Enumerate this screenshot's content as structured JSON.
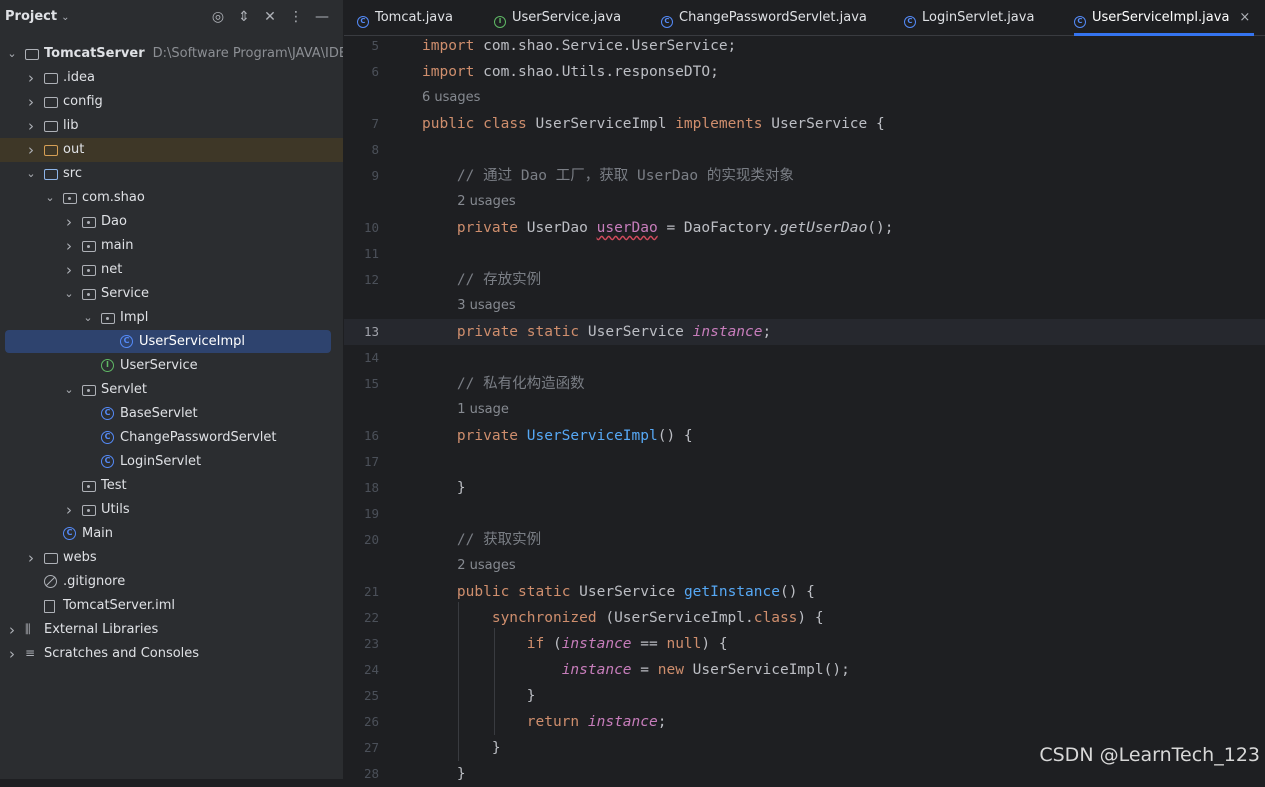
{
  "sidebar": {
    "title": "Project",
    "tree": [
      {
        "label": "TomcatServer",
        "path": "D:\\Software Program\\JAVA\\IDEA\\",
        "icon": "project-folder-icon",
        "state": "open",
        "bold": true
      },
      {
        "label": ".idea",
        "icon": "folder-icon",
        "state": "closed"
      },
      {
        "label": "config",
        "icon": "folder-icon",
        "state": "closed"
      },
      {
        "label": "lib",
        "icon": "folder-icon",
        "state": "closed"
      },
      {
        "label": "out",
        "icon": "excluded-folder-icon",
        "state": "closed",
        "highlight": true
      },
      {
        "label": "src",
        "icon": "source-folder-icon",
        "state": "open"
      },
      {
        "label": "com.shao",
        "icon": "package-icon",
        "state": "open"
      },
      {
        "label": "Dao",
        "icon": "package-icon",
        "state": "closed"
      },
      {
        "label": "main",
        "icon": "package-icon",
        "state": "closed"
      },
      {
        "label": "net",
        "icon": "package-icon",
        "state": "closed"
      },
      {
        "label": "Service",
        "icon": "package-icon",
        "state": "open"
      },
      {
        "label": "Impl",
        "icon": "package-icon",
        "state": "open"
      },
      {
        "label": "UserServiceImpl",
        "icon": "class-icon",
        "state": "none",
        "selected": true
      },
      {
        "label": "UserService",
        "icon": "interface-icon",
        "state": "none"
      },
      {
        "label": "Servlet",
        "icon": "package-icon",
        "state": "open"
      },
      {
        "label": "BaseServlet",
        "icon": "class-icon",
        "state": "none"
      },
      {
        "label": "ChangePasswordServlet",
        "icon": "class-icon",
        "state": "none"
      },
      {
        "label": "LoginServlet",
        "icon": "class-icon",
        "state": "none"
      },
      {
        "label": "Test",
        "icon": "package-icon",
        "state": "none"
      },
      {
        "label": "Utils",
        "icon": "package-icon",
        "state": "closed"
      },
      {
        "label": "Main",
        "icon": "class-icon",
        "state": "none"
      },
      {
        "label": "webs",
        "icon": "folder-icon",
        "state": "closed"
      },
      {
        "label": ".gitignore",
        "icon": "ignore-file-icon",
        "state": "none"
      },
      {
        "label": "TomcatServer.iml",
        "icon": "module-file-icon",
        "state": "none"
      },
      {
        "label": "External Libraries",
        "icon": "libraries-icon",
        "state": "closed"
      },
      {
        "label": "Scratches and Consoles",
        "icon": "scratches-icon",
        "state": "closed"
      }
    ]
  },
  "tabs": [
    {
      "label": "Tomcat.java",
      "icon": "class-icon"
    },
    {
      "label": "UserService.java",
      "icon": "interface-icon"
    },
    {
      "label": "ChangePasswordServlet.java",
      "icon": "class-icon"
    },
    {
      "label": "LoginServlet.java",
      "icon": "class-icon"
    },
    {
      "label": "UserServiceImpl.java",
      "icon": "class-icon",
      "active": true,
      "close": "×"
    }
  ],
  "editor": {
    "lines": [
      {
        "n": "5",
        "code": "import com.shao.Service.UserService;"
      },
      {
        "n": "6",
        "code": "import com.shao.Utils.responseDTO;"
      },
      {
        "usage": "6 usages"
      },
      {
        "n": "7",
        "code": "public class UserServiceImpl implements UserService {"
      },
      {
        "n": "8",
        "code": ""
      },
      {
        "n": "9",
        "code": "    // 通过 Dao 工厂，获取 UserDao 的实现类对象"
      },
      {
        "usage": "2 usages"
      },
      {
        "n": "10",
        "code": "    private UserDao userDao = DaoFactory.getUserDao();"
      },
      {
        "n": "11",
        "code": ""
      },
      {
        "n": "12",
        "code": "    // 存放实例"
      },
      {
        "usage": "3 usages"
      },
      {
        "n": "13",
        "code": "    private static UserService instance;",
        "current": true
      },
      {
        "n": "14",
        "code": ""
      },
      {
        "n": "15",
        "code": "    // 私有化构造函数"
      },
      {
        "usage": "1 usage"
      },
      {
        "n": "16",
        "code": "    private UserServiceImpl() {"
      },
      {
        "n": "17",
        "code": ""
      },
      {
        "n": "18",
        "code": "    }"
      },
      {
        "n": "19",
        "code": ""
      },
      {
        "n": "20",
        "code": "    // 获取实例"
      },
      {
        "usage": "2 usages"
      },
      {
        "n": "21",
        "code": "    public static UserService getInstance() {"
      },
      {
        "n": "22",
        "code": "        synchronized (UserServiceImpl.class) {"
      },
      {
        "n": "23",
        "code": "            if (instance == null) {"
      },
      {
        "n": "24",
        "code": "                instance = new UserServiceImpl();"
      },
      {
        "n": "25",
        "code": "            }"
      },
      {
        "n": "26",
        "code": "            return instance;"
      },
      {
        "n": "27",
        "code": "        }"
      },
      {
        "n": "28",
        "code": "    }"
      }
    ]
  },
  "watermark": "CSDN @LearnTech_123",
  "colors": {
    "accent": "#3574f0",
    "keyword": "#cf8e6d",
    "function": "#56a8f5",
    "field": "#c77dbb",
    "comment": "#7a7e85"
  }
}
